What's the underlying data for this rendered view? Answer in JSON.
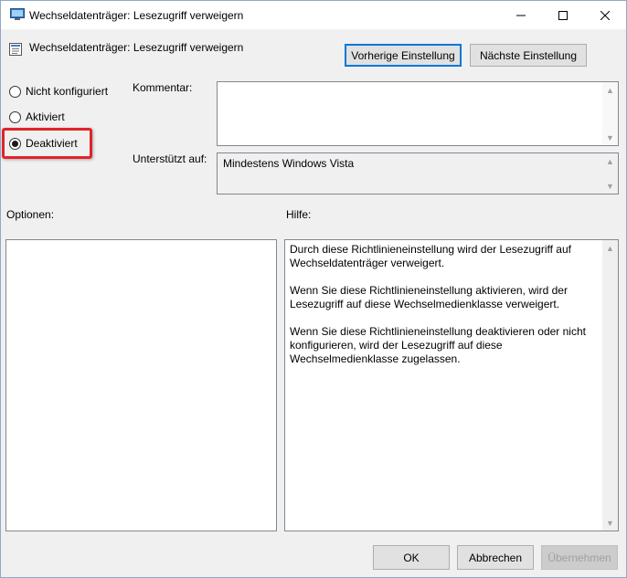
{
  "window": {
    "title": "Wechseldatenträger: Lesezugriff verweigern",
    "controls": {
      "minimize": "—",
      "maximize": "☐",
      "close": "✕"
    }
  },
  "header": {
    "title": "Wechseldatenträger: Lesezugriff verweigern",
    "prev_button": "Vorherige Einstellung",
    "next_button": "Nächste Einstellung"
  },
  "state": {
    "options": [
      {
        "label": "Nicht konfiguriert",
        "selected": false
      },
      {
        "label": "Aktiviert",
        "selected": false
      },
      {
        "label": "Deaktiviert",
        "selected": true
      }
    ],
    "highlight_color": "#e0242a"
  },
  "comment": {
    "label": "Kommentar:",
    "value": ""
  },
  "supported": {
    "label": "Unterstützt auf:",
    "value": "Mindestens Windows Vista"
  },
  "options_panel": {
    "label": "Optionen:"
  },
  "help_panel": {
    "label": "Hilfe:",
    "paragraphs": [
      "Durch diese Richtlinieneinstellung wird der Lesezugriff auf Wechseldatenträger verweigert.",
      "Wenn Sie diese Richtlinieneinstellung aktivieren, wird der Lesezugriff auf diese Wechselmedienklasse verweigert.",
      "Wenn Sie diese Richtlinieneinstellung deaktivieren oder nicht konfigurieren, wird der Lesezugriff auf diese Wechselmedienklasse zugelassen."
    ]
  },
  "footer": {
    "ok": "OK",
    "cancel": "Abbrechen",
    "apply": "Übernehmen"
  },
  "colors": {
    "accent": "#0078d7",
    "window_bg": "#f0f0f0"
  }
}
